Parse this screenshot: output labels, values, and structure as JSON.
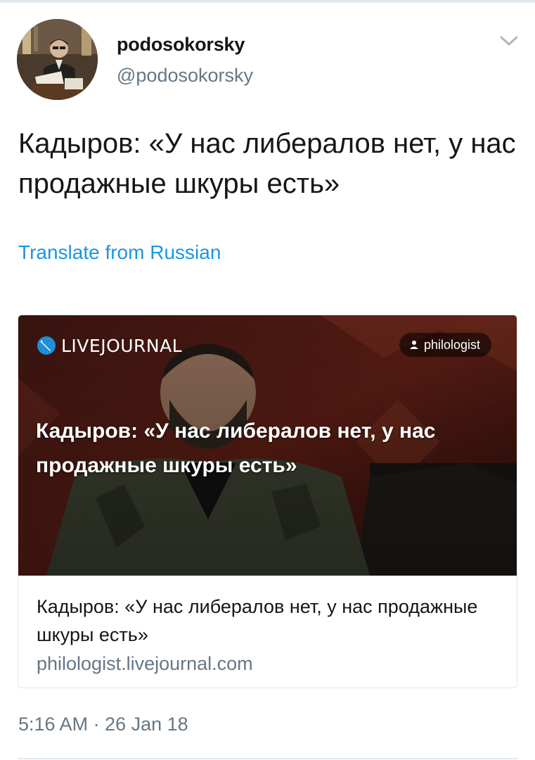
{
  "author": {
    "display_name": "podosokorsky",
    "handle": "@podosokorsky"
  },
  "tweet": {
    "text": "Кадыров: «У нас либералов нет, у нас продажные шкуры есть»",
    "translate_label": "Translate from Russian",
    "timestamp": "5:16 AM · 26 Jan 18"
  },
  "card": {
    "image": {
      "brand": "LIVEJOURNAL",
      "username": "philologist",
      "overlay_title": "Кадыров: «У нас либералов нет, у нас продажные шкуры есть»"
    },
    "title": "Кадыров: «У нас либералов нет, у нас продажные шкуры есть»",
    "domain": "philologist.livejournal.com"
  },
  "icons": {
    "chevron": "chevron-down-icon",
    "brand_logo": "livejournal-pen-icon",
    "user": "user-icon"
  },
  "colors": {
    "link": "#1b95e0",
    "secondary_text": "#657786",
    "primary_text": "#14171a",
    "border": "#e1e8ed",
    "livejournal_blue": "#1e8fd8"
  }
}
